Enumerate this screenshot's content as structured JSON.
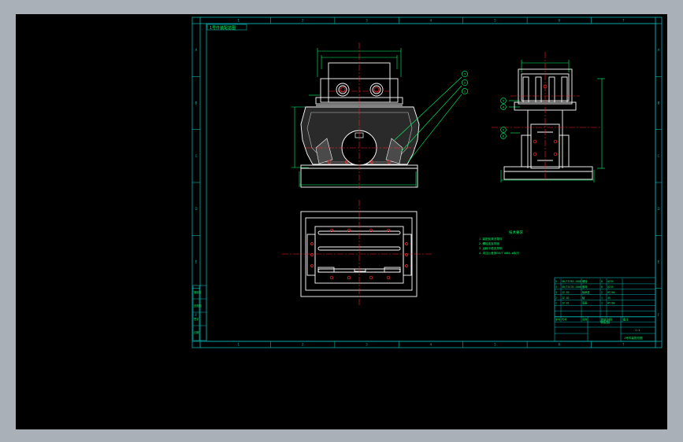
{
  "colors": {
    "background": "#000000",
    "frame": "#00b4b4",
    "part": "#ffffff",
    "dimension": "#00ff66",
    "centerline": "#ff2020",
    "hole": "#ff3030"
  },
  "sheet": {
    "corner_label": "1号件装配总图",
    "zone_numbers": [
      "1",
      "2",
      "3",
      "4",
      "5",
      "6",
      "7"
    ],
    "zone_letters": [
      "A",
      "B",
      "C",
      "D",
      "E",
      "F"
    ]
  },
  "front_view": {
    "balloons": [
      "3",
      "2",
      "1"
    ]
  },
  "side_view": {
    "balloons": [
      "5",
      "4",
      "9",
      "8"
    ]
  },
  "tech_requirements": {
    "heading": "技术要求",
    "lines": [
      "1.装配前清洗零件",
      "2.螺栓连接牢固",
      "3.运转平稳无异响",
      "4.未注公差按GB/T1804-m执行"
    ]
  },
  "title_block": {
    "parts_rows": [
      [
        "5",
        "GB/T5783-2000",
        "螺栓",
        "8",
        "Q235",
        ""
      ],
      [
        "4",
        "GB/T6170-2000",
        "螺母",
        "8",
        "Q235",
        ""
      ],
      [
        "3",
        "JZ-03",
        "轴承座",
        "2",
        "HT200",
        ""
      ],
      [
        "2",
        "JZ-02",
        "轴",
        "1",
        "45",
        ""
      ],
      [
        "1",
        "JZ-01",
        "底座",
        "1",
        "HT200",
        ""
      ],
      [
        "",
        "",
        "",
        "",
        "",
        ""
      ],
      [
        "",
        "",
        "",
        "",
        "",
        ""
      ]
    ],
    "header_row": [
      "序号",
      "代号",
      "名称",
      "数量",
      "材料",
      "备注"
    ],
    "drawing_name": "装配图",
    "scale": "1:1",
    "drawing_number": "1号件装配总图"
  },
  "revision_block": {
    "labels": [
      "借用件",
      "旧底图",
      "签字",
      "日期"
    ]
  }
}
